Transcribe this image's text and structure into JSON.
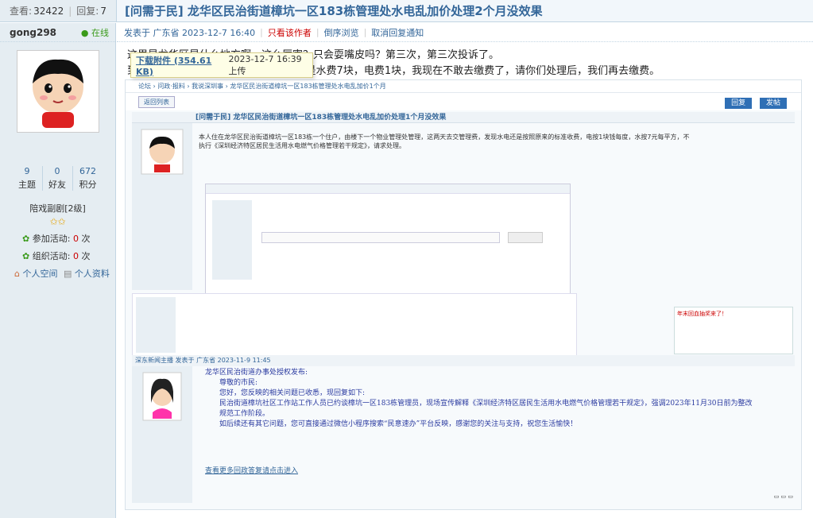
{
  "header": {
    "views_label": "查看:",
    "views": "32422",
    "replies_label": "回复:",
    "replies": "7",
    "title": "[问需于民] 龙华区民治街道樟坑一区183栋管理处水电乱加价处理2个月没效果"
  },
  "user": {
    "name": "gong298",
    "status": "在线",
    "stats": [
      {
        "num": "9",
        "label": "主题"
      },
      {
        "num": "0",
        "label": "好友"
      },
      {
        "num": "672",
        "label": "积分"
      }
    ],
    "rank": "陪戏副剧[2级]",
    "activity_join_label": "参加活动:",
    "activity_join": "0",
    "activity_org_label": "组织活动:",
    "activity_org": "0",
    "count_unit": "次",
    "space_link": "个人空间",
    "profile_link": "个人资料"
  },
  "meta": {
    "posted": "发表于 广东省 2023-12-7 16:40",
    "only_author": "只看该作者",
    "reverse": "倒序浏览",
    "cancel_notify": "取消回复通知"
  },
  "content": {
    "line1": "这里是龙华区是什么地方啊，这么厉害？只会耍嘴皮吗？第三次，第三次投诉了。",
    "line2": "到现在对于投诉电费水费问题，12月还是水费7块，电费1块，我现在不敢去缴费了，请你们处理后，我们再去缴费。"
  },
  "attachment": {
    "link": "下载附件 (354.61 KB)",
    "date": "2023-12-7 16:39 上传"
  },
  "embedded": {
    "nav": "论坛 › 问政·报料 › 我说深圳事 › 龙华区民治街道樟坑一区183栋管理处水电乱加价1个月",
    "back": "返回列表",
    "reply_btn": "回复",
    "post_btn": "发帖",
    "title": "[问需于民] 龙华区民治街道樟坑一区183栋管理处水电乱加价处理1个月没效果",
    "body": "本人住在龙华区民治街道樟坑一区183栋一个住户，由楼下一个物业管理处管理，这两天去交管理费，发现水电还是按照原来的标准收费，电按1块钱每度，水按7元每平方，不执行《深圳经济特区居民生活用水电燃气价格管理若干规定》，请求处理。",
    "notice": "年末回血抽奖来了！",
    "reply_header": "深东新闻主播 发表于 广东省 2023-11-9 11:45",
    "reply_lines": [
      "龙华区民治街道办事处授权发布:",
      "尊敬的市民:",
      "您好，您反映的相关问题已收悉，现回复如下:",
      "民治街道樟坑社区工作站工作人员已约谈樟坑一区183栋管理员，现场宣传解释《深圳经济特区居民生活用水电燃气价格管理若干规定》，强调2023年11月30日前为整改规范工作阶段。",
      "如后续还有其它问题，您可直接通过微信小程序搜索“民意速办”平台反映，感谢您的关注与支持，祝您生活愉快！"
    ],
    "reply_link": "查看更多回政答复请点击进入"
  }
}
